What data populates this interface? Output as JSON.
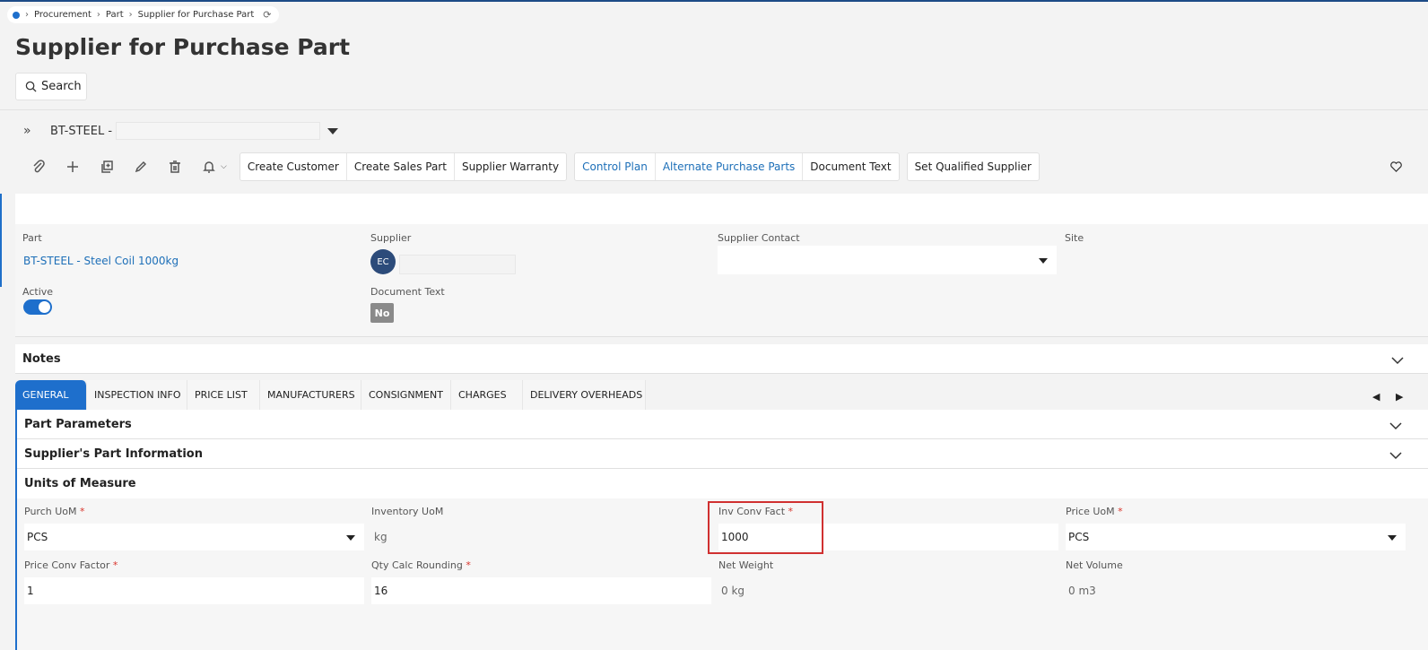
{
  "breadcrumb": {
    "items": [
      "Procurement",
      "Part",
      "Supplier for Purchase Part"
    ]
  },
  "page": {
    "title": "Supplier for Purchase Part",
    "search_label": "Search"
  },
  "record": {
    "key": "BT-STEEL -"
  },
  "toolbar": {
    "icons": [
      "attach-icon",
      "add-icon",
      "duplicate-icon",
      "edit-icon",
      "delete-icon",
      "bell-icon"
    ],
    "group1": [
      "Create Customer",
      "Create Sales Part",
      "Supplier Warranty"
    ],
    "group2": [
      "Control Plan",
      "Alternate Purchase Parts",
      "Document Text"
    ],
    "group3": [
      "Set Qualified Supplier"
    ]
  },
  "header": {
    "part_label": "Part",
    "part_value": "BT-STEEL - Steel Coil 1000kg",
    "supplier_label": "Supplier",
    "supplier_initials": "EC",
    "supplier_contact_label": "Supplier Contact",
    "site_label": "Site",
    "active_label": "Active",
    "active": true,
    "document_text_label": "Document Text",
    "document_text_value": "No"
  },
  "notes": {
    "label": "Notes"
  },
  "tabs": [
    "GENERAL",
    "INSPECTION INFO",
    "PRICE LIST",
    "MANUFACTURERS",
    "CONSIGNMENT",
    "CHARGES",
    "DELIVERY OVERHEADS"
  ],
  "sections": {
    "part_parameters": "Part Parameters",
    "supplier_part_info": "Supplier's Part Information",
    "units_of_measure": "Units of Measure"
  },
  "uom": {
    "purch_uom": {
      "label": "Purch UoM",
      "value": "PCS"
    },
    "inventory_uom": {
      "label": "Inventory UoM",
      "value": "kg"
    },
    "inv_conv_fact": {
      "label": "Inv Conv Fact",
      "value": "1000"
    },
    "price_uom": {
      "label": "Price UoM",
      "value": "PCS"
    },
    "price_conv_factor": {
      "label": "Price Conv Factor",
      "value": "1"
    },
    "qty_calc_rounding": {
      "label": "Qty Calc Rounding",
      "value": "16"
    },
    "net_weight": {
      "label": "Net Weight",
      "value": "0 kg"
    },
    "net_volume": {
      "label": "Net Volume",
      "value": "0 m3"
    }
  }
}
